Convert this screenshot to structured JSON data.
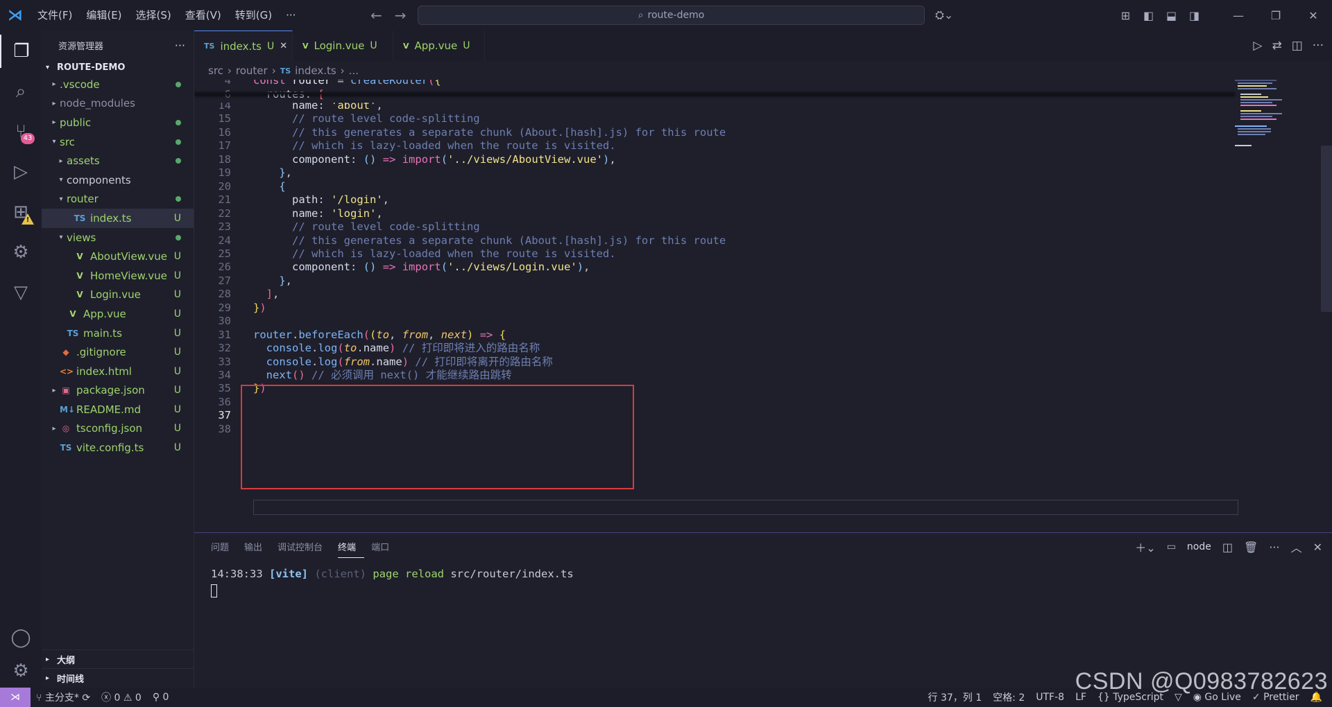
{
  "menu": [
    "文件(F)",
    "编辑(E)",
    "选择(S)",
    "查看(V)",
    "转到(G)",
    "···"
  ],
  "search": "route-demo",
  "activity": {
    "scm_badge": "43"
  },
  "sidebar": {
    "title": "资源管理器",
    "root": "ROUTE-DEMO",
    "tree": [
      {
        "label": ".vscode",
        "chev": "▸",
        "indent": 0,
        "status": "dot"
      },
      {
        "label": "node_modules",
        "chev": "▸",
        "indent": 0,
        "status": ""
      },
      {
        "label": "public",
        "chev": "▸",
        "indent": 0,
        "status": "dot"
      },
      {
        "label": "src",
        "chev": "▾",
        "indent": 0,
        "status": "dot"
      },
      {
        "label": "assets",
        "chev": "▸",
        "indent": 1,
        "status": "dot"
      },
      {
        "label": "components",
        "chev": "▾",
        "indent": 1,
        "status": ""
      },
      {
        "label": "router",
        "chev": "▾",
        "indent": 1,
        "status": "dot"
      },
      {
        "label": "index.ts",
        "chev": "",
        "indent": 2,
        "icon": "ts",
        "status": "U",
        "selected": true
      },
      {
        "label": "views",
        "chev": "▾",
        "indent": 1,
        "status": "dot"
      },
      {
        "label": "AboutView.vue",
        "chev": "",
        "indent": 2,
        "icon": "vue",
        "status": "U"
      },
      {
        "label": "HomeView.vue",
        "chev": "",
        "indent": 2,
        "icon": "vue",
        "status": "U"
      },
      {
        "label": "Login.vue",
        "chev": "",
        "indent": 2,
        "icon": "vue",
        "status": "U"
      },
      {
        "label": "App.vue",
        "chev": "",
        "indent": 1,
        "icon": "vue",
        "status": "U"
      },
      {
        "label": "main.ts",
        "chev": "",
        "indent": 1,
        "icon": "ts",
        "status": "U"
      },
      {
        "label": ".gitignore",
        "chev": "",
        "indent": 0,
        "icon": "git",
        "status": "U"
      },
      {
        "label": "index.html",
        "chev": "",
        "indent": 0,
        "icon": "html",
        "status": "U"
      },
      {
        "label": "package.json",
        "chev": "▸",
        "indent": 0,
        "icon": "json",
        "status": "U"
      },
      {
        "label": "README.md",
        "chev": "",
        "indent": 0,
        "icon": "md",
        "status": "U"
      },
      {
        "label": "tsconfig.json",
        "chev": "▸",
        "indent": 0,
        "icon": "tsconfig",
        "status": "U"
      },
      {
        "label": "vite.config.ts",
        "chev": "",
        "indent": 0,
        "icon": "ts",
        "status": "U"
      }
    ],
    "outline": "大纲",
    "timeline": "时间线"
  },
  "tabs": [
    {
      "label": "index.ts",
      "status": "U",
      "icon": "ts",
      "active": true
    },
    {
      "label": "Login.vue",
      "status": "U",
      "icon": "vue"
    },
    {
      "label": "App.vue",
      "status": "U",
      "icon": "vue"
    }
  ],
  "breadcrumb": [
    "src",
    "router",
    "index.ts",
    "..."
  ],
  "editor": {
    "sticky": [
      {
        "n": "4",
        "tokens": [
          [
            "kw",
            "const "
          ],
          [
            "var",
            "router "
          ],
          [
            "punc",
            "= "
          ],
          [
            "fn",
            "createRouter"
          ],
          [
            "par",
            "("
          ],
          [
            "br",
            "{"
          ]
        ]
      },
      {
        "n": "6",
        "tokens": [
          [
            "punc",
            "  "
          ],
          [
            "prop",
            "routes"
          ],
          [
            "punc",
            ": "
          ],
          [
            "brk",
            "["
          ]
        ]
      }
    ],
    "lines": [
      {
        "n": "14",
        "tokens": [
          [
            "punc",
            "      "
          ],
          [
            "prop",
            "name"
          ],
          [
            "punc",
            ": "
          ],
          [
            "str",
            "'about'"
          ],
          [
            "punc",
            ","
          ]
        ]
      },
      {
        "n": "15",
        "tokens": [
          [
            "cmt",
            "      // route level code-splitting"
          ]
        ]
      },
      {
        "n": "16",
        "tokens": [
          [
            "cmt",
            "      // this generates a separate chunk (About.[hash].js) for this route"
          ]
        ]
      },
      {
        "n": "17",
        "tokens": [
          [
            "cmt",
            "      // which is lazy-loaded when the route is visited."
          ]
        ]
      },
      {
        "n": "18",
        "tokens": [
          [
            "punc",
            "      "
          ],
          [
            "prop",
            "component"
          ],
          [
            "punc",
            ": "
          ],
          [
            "par2",
            "()"
          ],
          [
            "punc",
            " "
          ],
          [
            "ar",
            "=>"
          ],
          [
            "punc",
            " "
          ],
          [
            "imp",
            "import"
          ],
          [
            "par2",
            "("
          ],
          [
            "str",
            "'../views/AboutView.vue'"
          ],
          [
            "par2",
            ")"
          ],
          [
            "punc",
            ","
          ]
        ]
      },
      {
        "n": "19",
        "tokens": [
          [
            "punc",
            "    "
          ],
          [
            "par2",
            "}"
          ],
          [
            "punc",
            ","
          ]
        ]
      },
      {
        "n": "20",
        "tokens": [
          [
            "punc",
            "    "
          ],
          [
            "par2",
            "{"
          ]
        ]
      },
      {
        "n": "21",
        "tokens": [
          [
            "punc",
            "      "
          ],
          [
            "prop",
            "path"
          ],
          [
            "punc",
            ": "
          ],
          [
            "str",
            "'/login'"
          ],
          [
            "punc",
            ","
          ]
        ]
      },
      {
        "n": "22",
        "tokens": [
          [
            "punc",
            "      "
          ],
          [
            "prop",
            "name"
          ],
          [
            "punc",
            ": "
          ],
          [
            "str",
            "'login'"
          ],
          [
            "punc",
            ","
          ]
        ]
      },
      {
        "n": "23",
        "tokens": [
          [
            "cmt",
            "      // route level code-splitting"
          ]
        ]
      },
      {
        "n": "24",
        "tokens": [
          [
            "cmt",
            "      // this generates a separate chunk (About.[hash].js) for this route"
          ]
        ]
      },
      {
        "n": "25",
        "tokens": [
          [
            "cmt",
            "      // which is lazy-loaded when the route is visited."
          ]
        ]
      },
      {
        "n": "26",
        "tokens": [
          [
            "punc",
            "      "
          ],
          [
            "prop",
            "component"
          ],
          [
            "punc",
            ": "
          ],
          [
            "par2",
            "()"
          ],
          [
            "punc",
            " "
          ],
          [
            "ar",
            "=>"
          ],
          [
            "punc",
            " "
          ],
          [
            "imp",
            "import"
          ],
          [
            "par2",
            "("
          ],
          [
            "str",
            "'../views/Login.vue'"
          ],
          [
            "par2",
            ")"
          ],
          [
            "punc",
            ","
          ]
        ]
      },
      {
        "n": "27",
        "tokens": [
          [
            "punc",
            "    "
          ],
          [
            "par2",
            "}"
          ],
          [
            "punc",
            ","
          ]
        ]
      },
      {
        "n": "28",
        "tokens": [
          [
            "punc",
            "  "
          ],
          [
            "brk",
            "]"
          ],
          [
            "punc",
            ","
          ]
        ]
      },
      {
        "n": "29",
        "tokens": [
          [
            "br",
            "}"
          ],
          [
            "par",
            ")"
          ]
        ]
      },
      {
        "n": "30",
        "tokens": []
      },
      {
        "n": "31",
        "tokens": [
          [
            "fn",
            "router"
          ],
          [
            "punc",
            "."
          ],
          [
            "fn",
            "beforeEach"
          ],
          [
            "par",
            "("
          ],
          [
            "br",
            "("
          ],
          [
            "it",
            "to"
          ],
          [
            "punc",
            ", "
          ],
          [
            "it",
            "from"
          ],
          [
            "punc",
            ", "
          ],
          [
            "it",
            "next"
          ],
          [
            "br",
            ")"
          ],
          [
            "punc",
            " "
          ],
          [
            "ar",
            "=>"
          ],
          [
            "punc",
            " "
          ],
          [
            "br",
            "{"
          ]
        ]
      },
      {
        "n": "32",
        "tokens": [
          [
            "punc",
            "  "
          ],
          [
            "fn",
            "console"
          ],
          [
            "punc",
            "."
          ],
          [
            "fn",
            "log"
          ],
          [
            "par",
            "("
          ],
          [
            "it",
            "to"
          ],
          [
            "punc",
            "."
          ],
          [
            "prop",
            "name"
          ],
          [
            "par",
            ")"
          ],
          [
            "cmt",
            " // 打印即将进入的路由名称"
          ]
        ]
      },
      {
        "n": "33",
        "tokens": [
          [
            "punc",
            "  "
          ],
          [
            "fn",
            "console"
          ],
          [
            "punc",
            "."
          ],
          [
            "fn",
            "log"
          ],
          [
            "par",
            "("
          ],
          [
            "it",
            "from"
          ],
          [
            "punc",
            "."
          ],
          [
            "prop",
            "name"
          ],
          [
            "par",
            ")"
          ],
          [
            "cmt",
            " // 打印即将离开的路由名称"
          ]
        ]
      },
      {
        "n": "34",
        "tokens": [
          [
            "punc",
            "  "
          ],
          [
            "fn",
            "next"
          ],
          [
            "par",
            "()"
          ],
          [
            "cmt",
            " // 必须调用 next() 才能继续路由跳转"
          ]
        ]
      },
      {
        "n": "35",
        "tokens": [
          [
            "br",
            "}"
          ],
          [
            "par",
            ")"
          ]
        ]
      },
      {
        "n": "36",
        "tokens": []
      },
      {
        "n": "37",
        "tokens": []
      },
      {
        "n": "38",
        "tokens": []
      }
    ]
  },
  "panel": {
    "tabs": [
      "问题",
      "输出",
      "调试控制台",
      "终端",
      "端口"
    ],
    "active_tab": "终端",
    "terminal_name": "node",
    "output": {
      "time": "14:38:33",
      "vite": "[vite]",
      "client": "(client)",
      "msg": "page reload",
      "path": "src/router/index.ts"
    }
  },
  "status": {
    "branch": "主分支*",
    "errors": "0",
    "warnings": "0",
    "ports": "0",
    "position": "行 37，列 1",
    "spaces": "空格: 2",
    "encoding": "UTF-8",
    "eol": "LF",
    "language": "TypeScript",
    "golive": "Go Live",
    "prettier": "Prettier"
  },
  "watermark": "CSDN @Q0983782623",
  "colors": {
    "accent": "#a77ad9",
    "highlight_box": "#d93a3d",
    "untracked": "#9fd36c"
  }
}
